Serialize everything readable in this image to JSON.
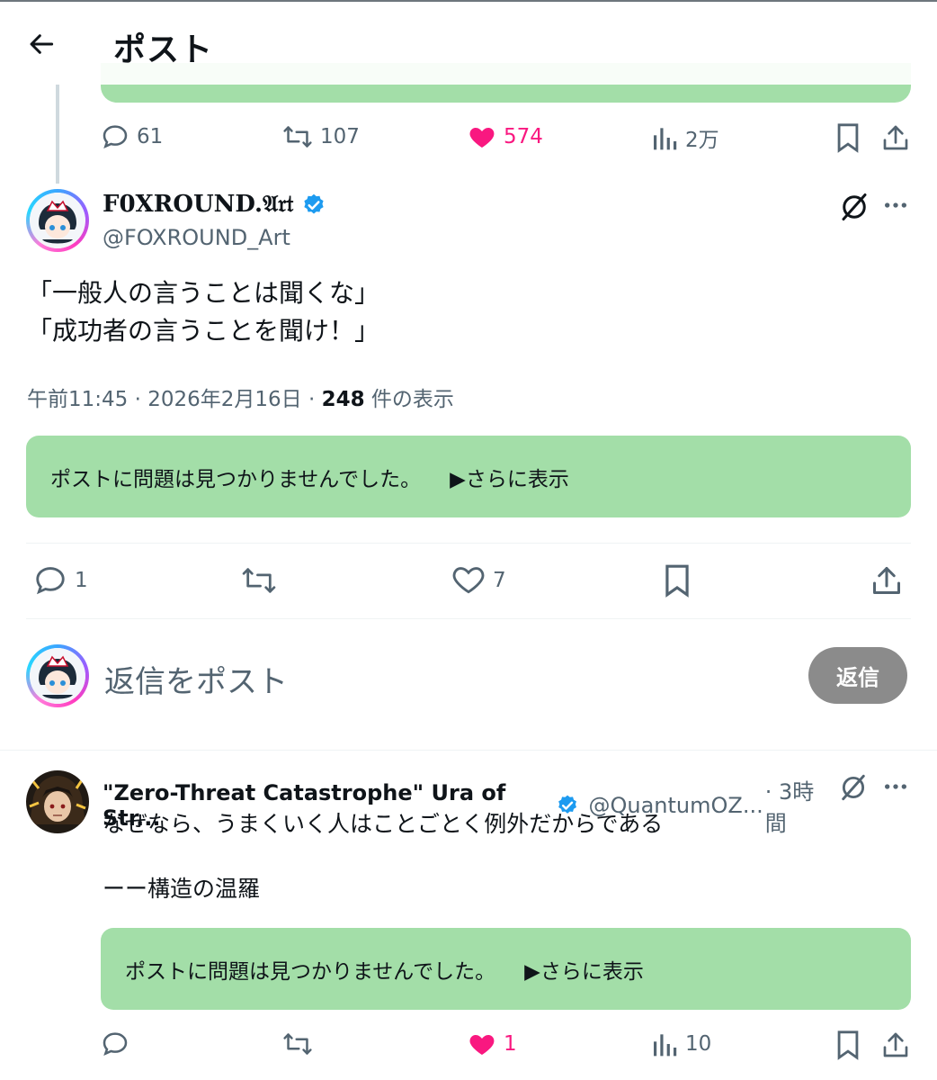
{
  "header": {
    "title": "ポスト",
    "back_icon": "arrow-left-icon"
  },
  "previous_post": {
    "replies": "61",
    "reposts": "107",
    "likes": "574",
    "views": "2万"
  },
  "main_post": {
    "display_name": "F0XROUND.𝔄𝔯𝔱",
    "handle": "@FOXROUND_Art",
    "text_line1": "「一般人の言うことは聞くな」",
    "text_line2": "「成功者の言うことを聞け！」",
    "timestamp": "午前11:45 · 2026年2月16日 · ",
    "views_count": "248",
    "views_label": " 件の表示",
    "note_text": "ポストに問題は見つかりませんでした。",
    "note_more": "▶さらに表示",
    "replies": "1",
    "reposts": "",
    "likes": "7"
  },
  "composer": {
    "placeholder": "返信をポスト",
    "button": "返信"
  },
  "reply_post": {
    "display_name": "\"Zero-Threat Catastrophe\" Ura of Str...",
    "handle": "@QuantumOZ...",
    "time": " · 3時間",
    "text_line1": "なぜなら、うまくいく人はことごとく例外だからである",
    "text_line2": "ーー構造の温羅",
    "note_text": "ポストに問題は見つかりませんでした。",
    "note_more": "▶さらに表示",
    "replies": "",
    "reposts": "",
    "likes": "1",
    "views": "10"
  },
  "colors": {
    "accent_like": "#f91880",
    "verified": "#1d9bf0",
    "note_green": "#a3dea8",
    "muted_text": "#536471"
  }
}
